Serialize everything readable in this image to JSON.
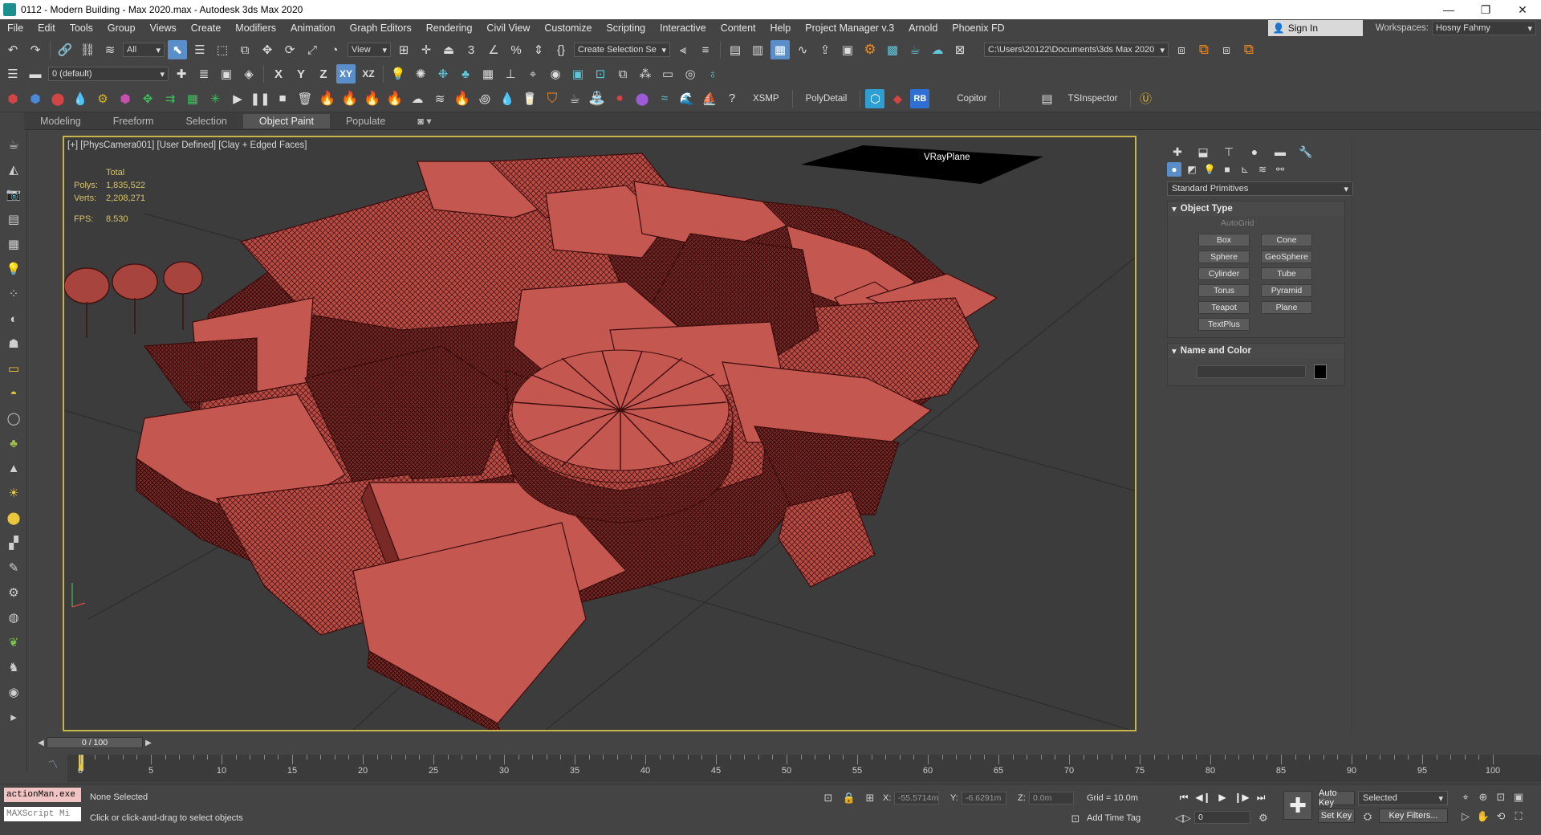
{
  "window": {
    "title": "0112 - Modern Building - Max 2020.max - Autodesk 3ds Max 2020",
    "minimize": "—",
    "restore": "❐",
    "close": "✕"
  },
  "menu": {
    "items": [
      "File",
      "Edit",
      "Tools",
      "Group",
      "Views",
      "Create",
      "Modifiers",
      "Animation",
      "Graph Editors",
      "Rendering",
      "Civil View",
      "Customize",
      "Scripting",
      "Interactive",
      "Content",
      "Help",
      "Project Manager v.3",
      "Arnold",
      "Phoenix FD"
    ],
    "sign_in": "Sign In",
    "workspaces_label": "Workspaces:",
    "workspace_value": "Hosny Fahmy"
  },
  "toolbar1": {
    "selection_filter": "All",
    "ref_coord": "View",
    "named_selection": "Create Selection Se",
    "project_path": "C:\\Users\\20122\\Documents\\3ds Max 2020"
  },
  "toolbar2": {
    "layer": "0 (default)",
    "axis_x": "X",
    "axis_y": "Y",
    "axis_z": "Z",
    "axis_xy": "XY",
    "axis_xz": "XZ"
  },
  "toolbar3": {
    "xsmp": "XSMP",
    "polydetail": "PolyDetail",
    "rb": "RB",
    "copitor": "Copitor",
    "tsinspector": "TSInspector"
  },
  "ribbon": {
    "tabs": [
      "Modeling",
      "Freeform",
      "Selection",
      "Object Paint",
      "Populate"
    ],
    "active": "Object Paint"
  },
  "viewport": {
    "label": "[+] [PhysCamera001] [User Defined] [Clay + Edged Faces]",
    "stats_total": "Total",
    "polys_label": "Polys:",
    "polys_value": "1,835,522",
    "verts_label": "Verts:",
    "verts_value": "2,208,271",
    "fps_label": "FPS:",
    "fps_value": "8.530",
    "plane_label": "VRayPlane"
  },
  "command_panel": {
    "category": "Standard Primitives",
    "object_type_title": "Object Type",
    "autogrid": "AutoGrid",
    "primitives": [
      "Box",
      "Cone",
      "Sphere",
      "GeoSphere",
      "Cylinder",
      "Tube",
      "Torus",
      "Pyramid",
      "Teapot",
      "Plane",
      "TextPlus"
    ],
    "name_color_title": "Name and Color"
  },
  "time_slider": {
    "value": "0 / 100"
  },
  "timeline": {
    "labels": [
      "0",
      "5",
      "10",
      "15",
      "20",
      "25",
      "30",
      "35",
      "40",
      "45",
      "50",
      "55",
      "60",
      "65",
      "70",
      "75",
      "80",
      "85",
      "90",
      "95",
      "100"
    ]
  },
  "status": {
    "script_listener": "actionMan.exe",
    "maxscript": "MAXScript Mi",
    "selection": "None Selected",
    "prompt": "Click or click-and-drag to select objects",
    "x_label": "X:",
    "x_value": "-55.5714m",
    "y_label": "Y:",
    "y_value": "-6.6291m",
    "z_label": "Z:",
    "z_value": "0.0m",
    "grid": "Grid = 10.0m",
    "add_time_tag": "Add Time Tag",
    "frame": "0",
    "auto_key": "Auto Key",
    "set_key": "Set Key",
    "selected": "Selected",
    "key_filters": "Key Filters..."
  },
  "colors": {
    "accent": "#5a8ec8",
    "viewport_border": "#c8b54a",
    "model_fill": "#c4574f",
    "model_edges": "#3d0d0d",
    "stats": "#d4c26a"
  }
}
